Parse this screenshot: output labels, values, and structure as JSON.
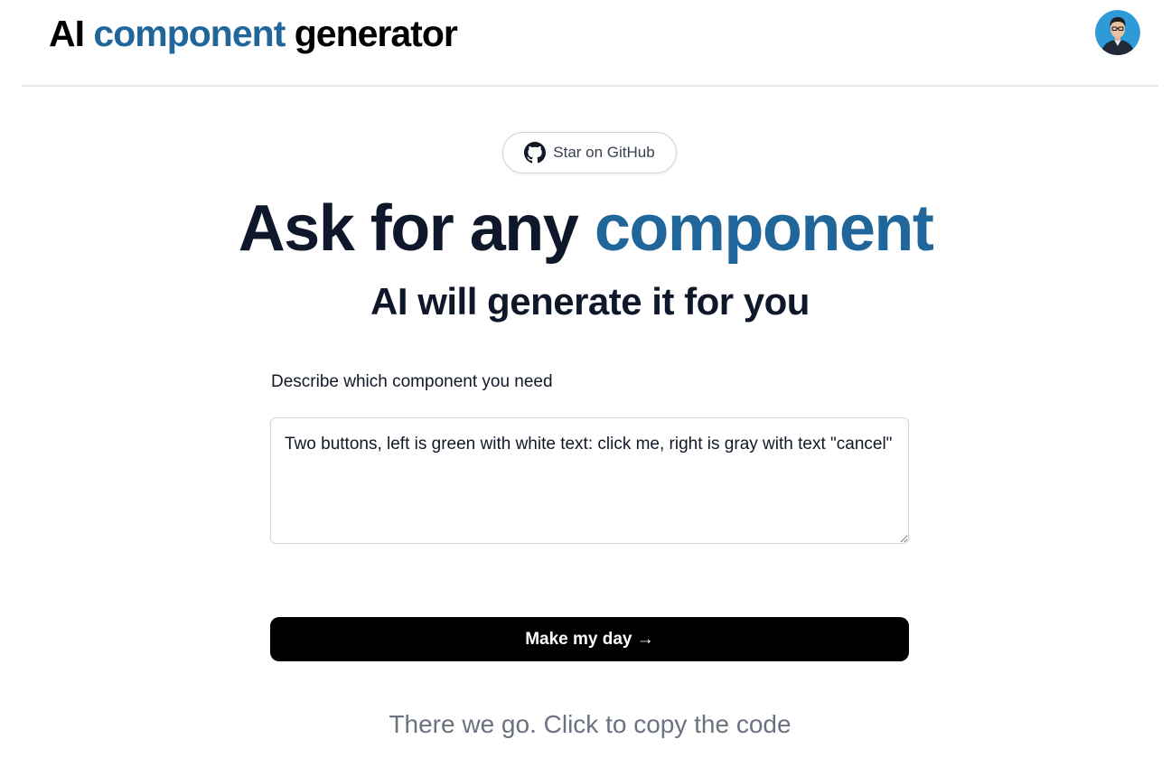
{
  "header": {
    "logo_prefix": "AI ",
    "logo_accent": "component",
    "logo_suffix": " generator",
    "avatar_icon": "user-avatar"
  },
  "github_button": {
    "label": "Star on GitHub",
    "icon": "github-icon"
  },
  "hero": {
    "title_prefix": "Ask for any ",
    "title_accent": "component",
    "subtitle": "AI will generate it for you"
  },
  "form": {
    "label": "Describe which component you need",
    "prompt_value": "Two buttons, left is green with white text: click me, right is gray with text \"cancel\"",
    "submit_label": "Make my day →"
  },
  "result": {
    "copy_hint": "There we go. Click to copy the code"
  },
  "colors": {
    "accent": "#20669b",
    "text": "#0f172a",
    "button_bg": "#000000",
    "hint": "#6b7280"
  }
}
